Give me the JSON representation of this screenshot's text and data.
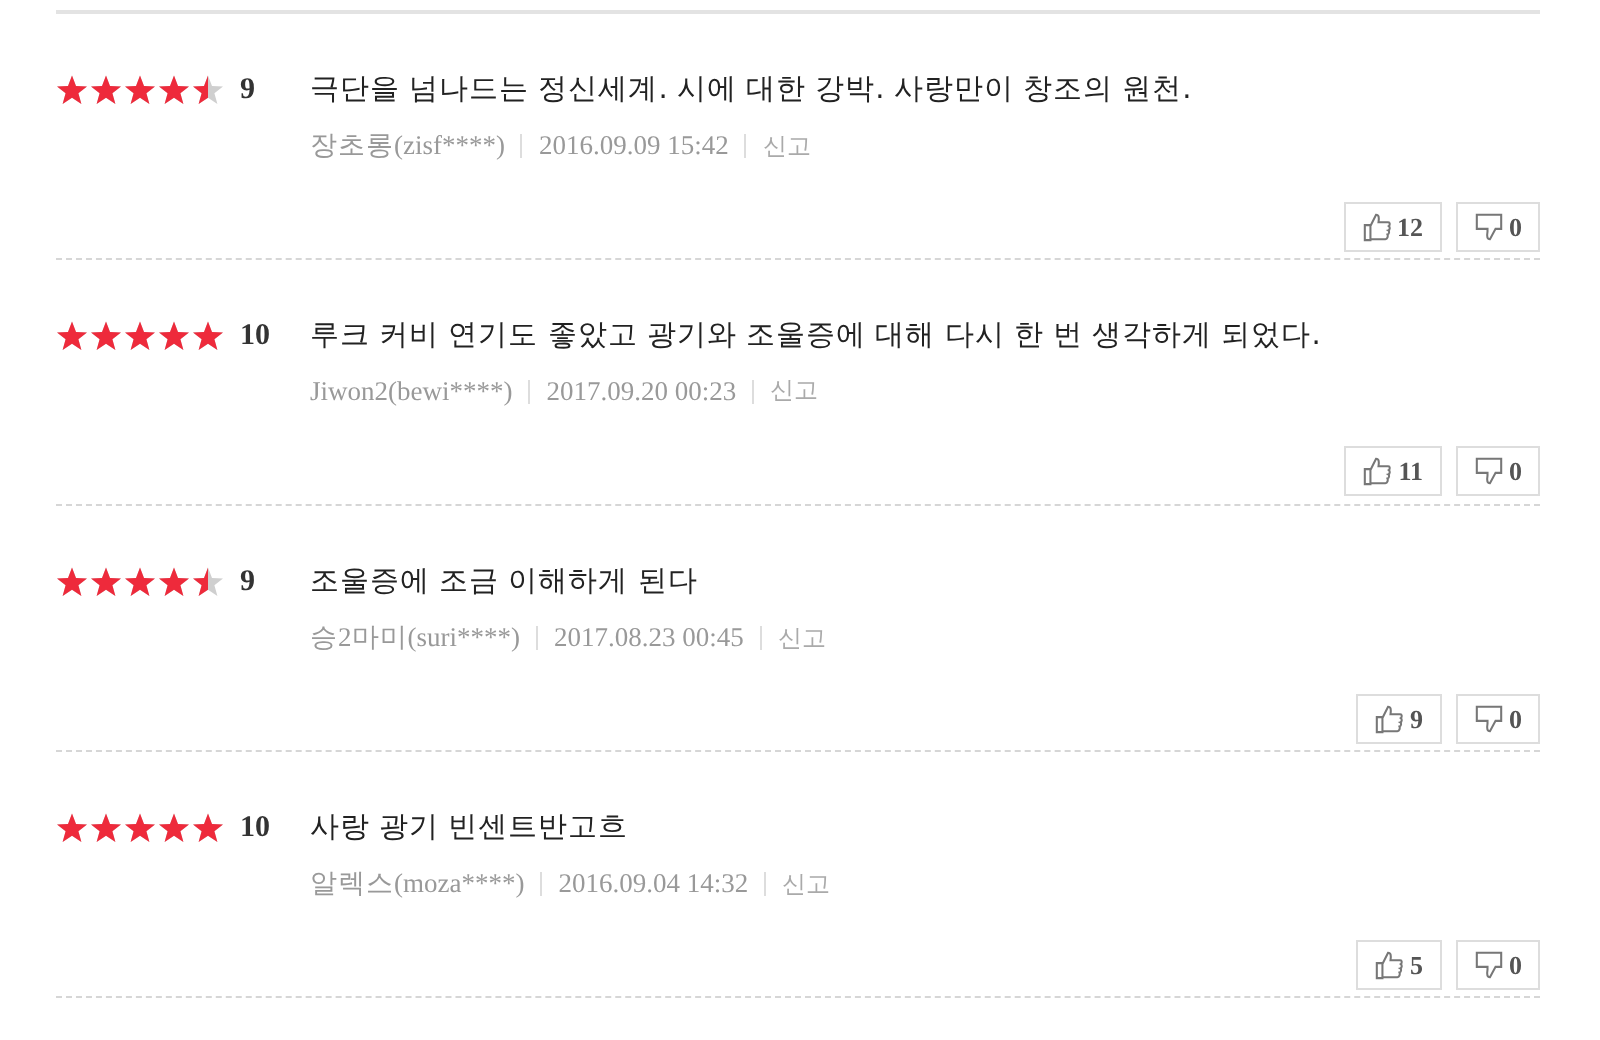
{
  "reviews": [
    {
      "stars": 4.5,
      "score": "9",
      "text": "극단을 넘나드는 정신세계. 시에 대한 강박. 사랑만이 창조의 원천.",
      "author": "장초롱(zisf****)",
      "date": "2016.09.09 15:42",
      "report": "신고",
      "likes": "12",
      "dislikes": "0"
    },
    {
      "stars": 5,
      "score": "10",
      "text": "루크 커비 연기도 좋았고 광기와 조울증에 대해 다시 한 번 생각하게 되었다.",
      "author": "Jiwon2(bewi****)",
      "date": "2017.09.20 00:23",
      "report": "신고",
      "likes": "11",
      "dislikes": "0"
    },
    {
      "stars": 4.5,
      "score": "9",
      "text": "조울증에 조금 이해하게 된다",
      "author": "승2마미(suri****)",
      "date": "2017.08.23 00:45",
      "report": "신고",
      "likes": "9",
      "dislikes": "0"
    },
    {
      "stars": 5,
      "score": "10",
      "text": "사랑 광기 빈센트반고흐",
      "author": "알렉스(moza****)",
      "date": "2016.09.04 14:32",
      "report": "신고",
      "likes": "5",
      "dislikes": "0"
    }
  ]
}
